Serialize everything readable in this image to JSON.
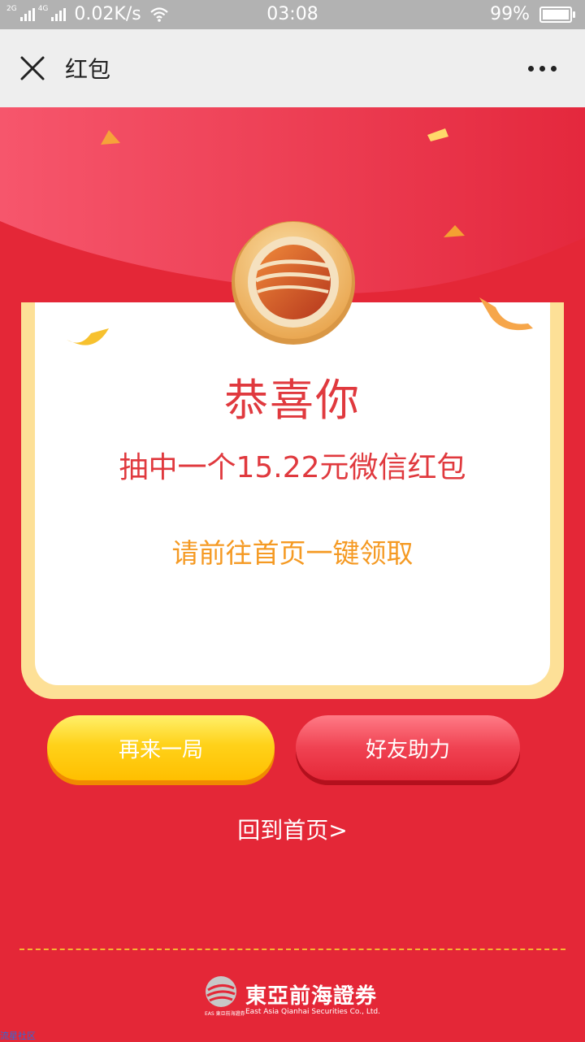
{
  "status_bar": {
    "network_2g": "2G",
    "network_4g": "4G",
    "speed": "0.02K/s",
    "time": "03:08",
    "battery": "99%"
  },
  "nav": {
    "title": "红包"
  },
  "card": {
    "congrats": "恭喜你",
    "prize": "抽中一个15.22元微信红包",
    "hint": "请前往首页一键领取"
  },
  "buttons": {
    "again": "再来一局",
    "help": "好友助力"
  },
  "home_link": "回到首页>",
  "footer": {
    "logo_cn": "東亞前海證券",
    "logo_en": "East Asia Qianhai Securities Co., Ltd.",
    "logo_small": "EAS 東亞前海證券"
  },
  "watermark": "流星社区",
  "colors": {
    "background_red": "#e42737",
    "card_border": "#fde097",
    "title_red": "#e0393e",
    "hint_orange": "#f59a23"
  }
}
